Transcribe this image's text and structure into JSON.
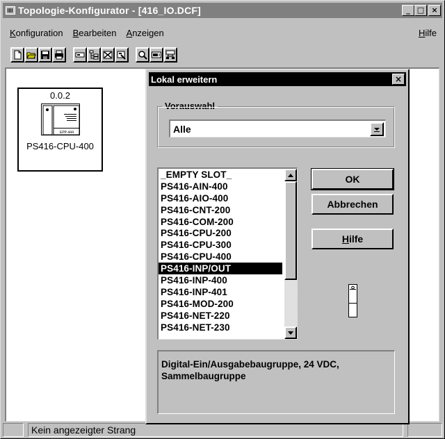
{
  "window": {
    "title": "Topologie-Konfigurator - [416_IO.DCF]",
    "controls": {
      "minimize": "_",
      "maximize": "□",
      "close": "×"
    }
  },
  "menu": {
    "items": [
      {
        "label": "Konfiguration",
        "accel": "K",
        "rest": "onfiguration"
      },
      {
        "label": "Bearbeiten",
        "accel": "B",
        "rest": "earbeiten"
      },
      {
        "label": "Anzeigen",
        "accel": "A",
        "rest": "nzeigen"
      }
    ],
    "help": {
      "label": "Hilfe",
      "accel": "H",
      "rest": "ilfe"
    }
  },
  "toolbar": {
    "groups": [
      [
        "new-icon",
        "open-icon",
        "save-icon",
        "print-icon"
      ],
      [
        "module-icon",
        "tree-icon",
        "delete-module-icon",
        "properties-icon"
      ],
      [
        "zoom-icon",
        "monitor-icon",
        "network-icon"
      ]
    ]
  },
  "workspace": {
    "node": {
      "address": "0.0.2",
      "module_name": "PS416-CPU-400",
      "icon_caption": "EPP-444"
    }
  },
  "dialog": {
    "title": "Lokal erweitern",
    "close_label": "×",
    "preselection": {
      "legend": "Vorauswahl",
      "selected": "Alle"
    },
    "modules": [
      "_EMPTY SLOT_",
      "PS416-AIN-400",
      "PS416-AIO-400",
      "PS416-CNT-200",
      "PS416-COM-200",
      "PS416-CPU-200",
      "PS416-CPU-300",
      "PS416-CPU-400",
      "PS416-INP/OUT",
      "PS416-INP-400",
      "PS416-INP-401",
      "PS416-MOD-200",
      "PS416-NET-220",
      "PS416-NET-230"
    ],
    "selected_index": 8,
    "buttons": {
      "ok": "OK",
      "cancel": "Abbrechen",
      "help": "Hilfe",
      "help_accel": "H",
      "help_rest": "ilfe"
    },
    "description": "Digital-Ein/Ausgabebaugruppe, 24 VDC, Sammelbaugruppe"
  },
  "statusbar": {
    "text": "Kein angezeigter Strang"
  },
  "colors": {
    "face": "#c0c0c0",
    "title_inactive": "#808080",
    "title_active": "#000000",
    "selection": "#000000"
  }
}
